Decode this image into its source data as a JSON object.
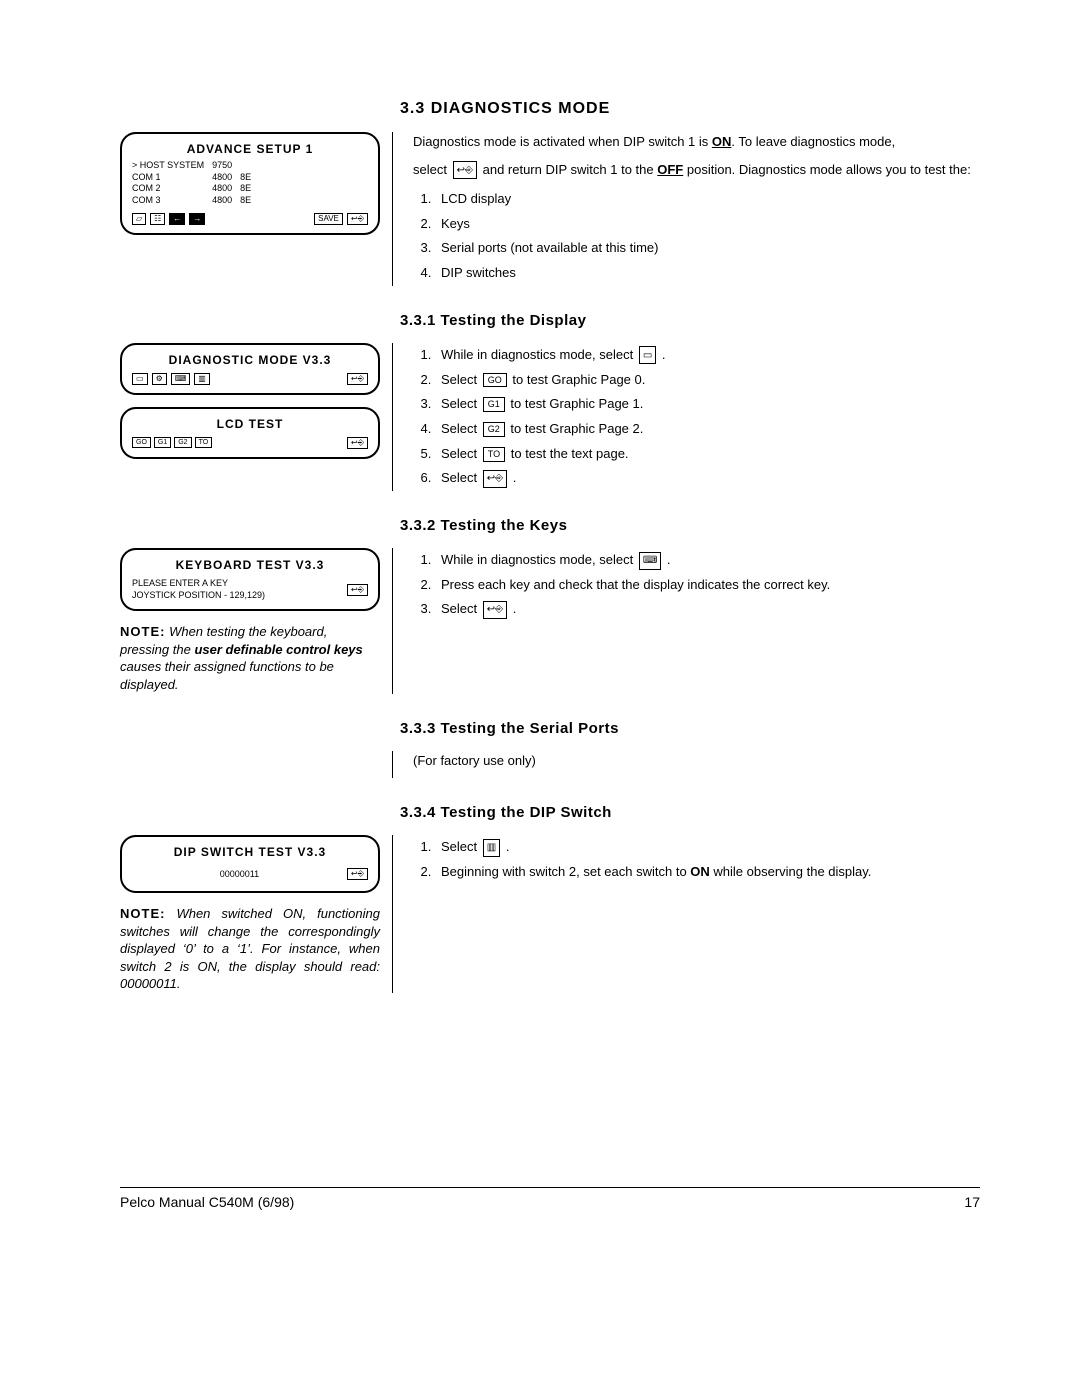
{
  "headings": {
    "h_33": "3.3  DIAGNOSTICS MODE",
    "h_331": "3.3.1  Testing the Display",
    "h_332": "3.3.2  Testing the Keys",
    "h_333": "3.3.3  Testing the Serial Ports",
    "h_334": "3.3.4  Testing the DIP Switch"
  },
  "panels": {
    "advance": {
      "title": "ADVANCE SETUP 1",
      "rows": [
        [
          "> HOST SYSTEM",
          "9750",
          ""
        ],
        [
          "COM 1",
          "4800",
          "8E"
        ],
        [
          "COM 2",
          "4800",
          "8E"
        ],
        [
          "COM 3",
          "4800",
          "8E"
        ]
      ],
      "save": "SAVE"
    },
    "diag": {
      "title": "DIAGNOSTIC MODE V3.3"
    },
    "lcd": {
      "title": "LCD TEST",
      "keys": [
        "GO",
        "G1",
        "G2",
        "TO"
      ]
    },
    "keyb": {
      "title": "KEYBOARD TEST V3.3",
      "line1": "PLEASE ENTER A KEY",
      "line2": "JOYSTICK POSITION - 129,129)"
    },
    "dip": {
      "title": "DIP SWITCH TEST V3.3",
      "value": "00000011"
    }
  },
  "notes": {
    "keyb": {
      "label": "NOTE:",
      "text": "When testing the keyboard, pressing the ",
      "bold": "user definable control keys",
      "rest": " causes their assigned functions to be displayed."
    },
    "dip": {
      "label": "NOTE:",
      "text": "When switched ON, functioning switches will change the correspondingly displayed ‘0’ to a ‘1’. For instance, when switch 2 is ON, the display should read: 00000011."
    }
  },
  "body": {
    "intro1a": "Diagnostics mode is activated when DIP switch 1 is ",
    "on": "ON",
    "intro1b": ". To leave diagnostics mode,",
    "intro2a": "select",
    "intro2b": "and return DIP switch 1 to the ",
    "off": "OFF",
    "intro2c": " position. Diagnostics mode allows you to test the:",
    "list33": [
      "LCD display",
      "Keys",
      "Serial ports (not available at this time)",
      "DIP switches"
    ],
    "s331": {
      "l1a": "While in diagnostics mode, select",
      "l2a": "Select",
      "l2b": "to test Graphic Page 0.",
      "l3a": "Select",
      "l3b": "to test Graphic Page 1.",
      "l4a": "Select",
      "l4b": "to test Graphic Page 2.",
      "l5a": "Select",
      "l5b": "to test the text page.",
      "l6a": "Select",
      "keys": {
        "go": "GO",
        "g1": "G1",
        "g2": "G2",
        "to": "TO"
      }
    },
    "s332": {
      "l1": "While in diagnostics mode, select",
      "l2": "Press each key and check that the display indicates the correct key.",
      "l3": "Select"
    },
    "s333": "(For factory use only)",
    "s334": {
      "l1": "Select",
      "l2a": "Beginning with switch 2, set each switch to ",
      "on": "ON",
      "l2b": " while observing the display."
    }
  },
  "footer": {
    "left": "Pelco Manual C540M (6/98)",
    "right": "17"
  }
}
